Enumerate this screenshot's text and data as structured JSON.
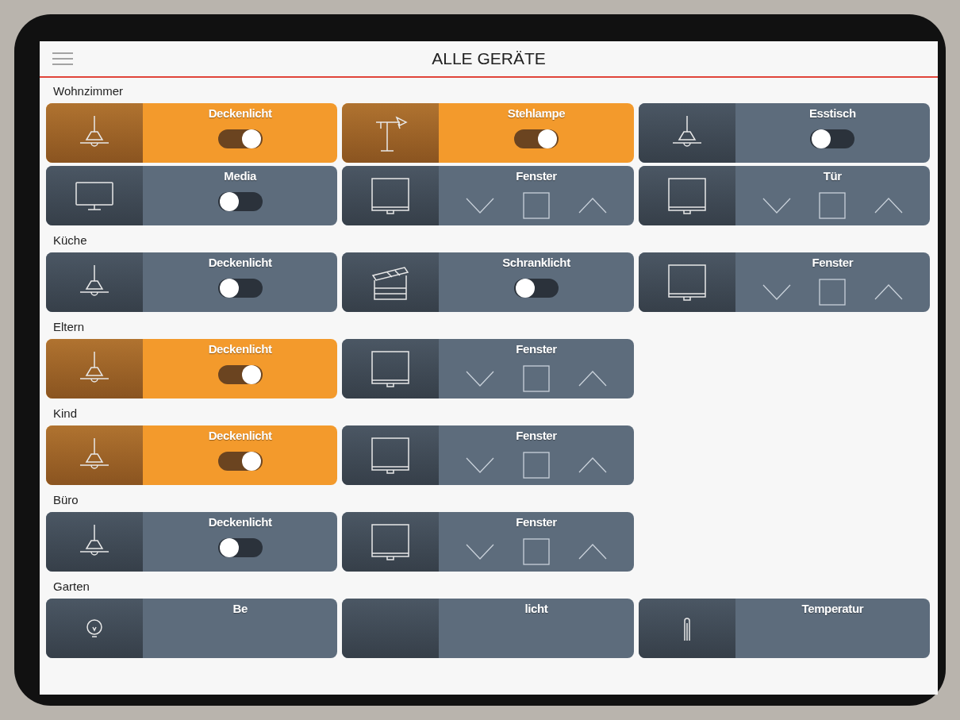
{
  "header": {
    "title": "ALLE GERÄTE"
  },
  "sections": [
    {
      "name": "Wohnzimmer",
      "devices": [
        {
          "kind": "ceiling-light",
          "label": "Deckenlicht",
          "on": true
        },
        {
          "kind": "floor-light",
          "label": "Stehlampe",
          "on": true
        },
        {
          "kind": "ceiling-light",
          "label": "Esstisch",
          "on": false
        },
        {
          "kind": "media",
          "label": "Media",
          "on": false
        },
        {
          "kind": "blind",
          "label": "Fenster"
        },
        {
          "kind": "blind",
          "label": "Tür"
        }
      ]
    },
    {
      "name": "Küche",
      "devices": [
        {
          "kind": "ceiling-light",
          "label": "Deckenlicht",
          "on": false
        },
        {
          "kind": "cabinet-light",
          "label": "Schranklicht",
          "on": false
        },
        {
          "kind": "blind",
          "label": "Fenster"
        }
      ]
    },
    {
      "name": "Eltern",
      "devices": [
        {
          "kind": "ceiling-light",
          "label": "Deckenlicht",
          "on": true
        },
        {
          "kind": "blind",
          "label": "Fenster"
        }
      ]
    },
    {
      "name": "Kind",
      "devices": [
        {
          "kind": "ceiling-light",
          "label": "Deckenlicht",
          "on": true
        },
        {
          "kind": "blind",
          "label": "Fenster"
        }
      ]
    },
    {
      "name": "Büro",
      "devices": [
        {
          "kind": "ceiling-light",
          "label": "Deckenlicht",
          "on": false
        },
        {
          "kind": "blind",
          "label": "Fenster"
        }
      ]
    },
    {
      "name": "Garten",
      "devices": [
        {
          "kind": "garden-light",
          "label": "Be"
        },
        {
          "kind": "covered",
          "label": "licht"
        },
        {
          "kind": "temperature",
          "label": "Temperatur"
        }
      ]
    }
  ]
}
